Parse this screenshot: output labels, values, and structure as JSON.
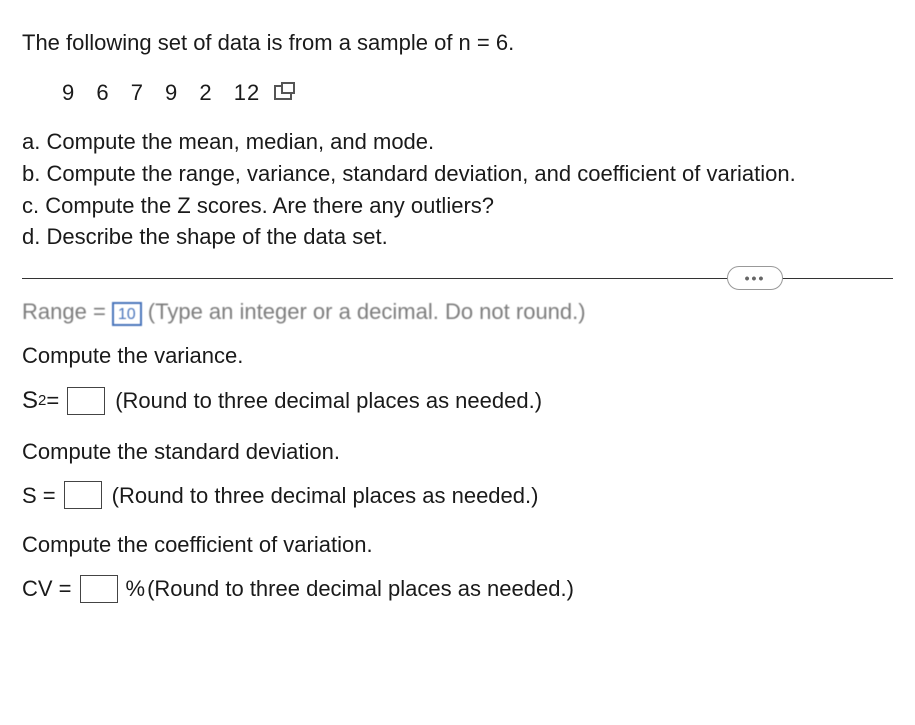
{
  "intro": "The following set of data is from a sample of n = 6.",
  "data_values": "9  6  7  9  2  12",
  "parts": {
    "a": "a. Compute the mean, median, and mode.",
    "b": "b. Compute the range, variance, standard deviation, and coefficient of variation.",
    "c": "c. Compute the Z scores. Are there any outliers?",
    "d": "d. Describe the shape of the data set."
  },
  "ellipsis": "•••",
  "grainy_line": {
    "prefix": "Range =",
    "prev_val": "10",
    "suffix": "(Type an integer or a decimal. Do not round.)"
  },
  "variance": {
    "prompt": "Compute the variance.",
    "lhs": "S",
    "sup": "2",
    "eq": " = ",
    "hint": "(Round to three decimal places as needed.)"
  },
  "stddev": {
    "prompt": "Compute the standard deviation.",
    "lhs": "S = ",
    "hint": "(Round to three decimal places as needed.)"
  },
  "cv": {
    "prompt": "Compute the coefficient of variation.",
    "lhs": "CV = ",
    "unit": "%",
    "hint": " (Round to three decimal places as needed.)"
  }
}
